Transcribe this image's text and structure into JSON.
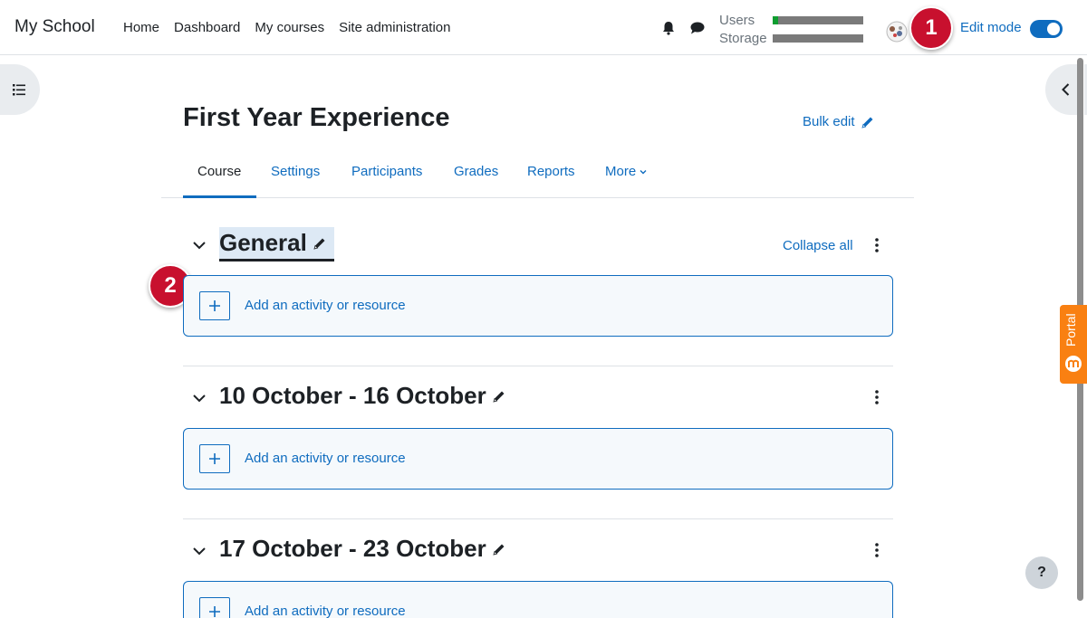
{
  "site": {
    "name": "My School"
  },
  "nav": {
    "items": [
      "Home",
      "Dashboard",
      "My courses",
      "Site administration"
    ]
  },
  "quota": {
    "users_label": "Users",
    "storage_label": "Storage",
    "users_used_fraction": 0.06,
    "storage_used_fraction": 0.0
  },
  "header": {
    "edit_mode_label": "Edit mode",
    "edit_mode_on": true
  },
  "callouts": {
    "first": "1",
    "second": "2"
  },
  "course": {
    "title": "First Year Experience",
    "bulk_edit_label": "Bulk edit",
    "tabs": [
      "Course",
      "Settings",
      "Participants",
      "Grades",
      "Reports",
      "More"
    ],
    "active_tab": "Course",
    "collapse_all_label": "Collapse all",
    "add_activity_label": "Add an activity or resource",
    "sections": [
      {
        "title": "General"
      },
      {
        "title": "10 October - 16 October"
      },
      {
        "title": "17 October - 23 October"
      }
    ]
  },
  "portal": {
    "label": "Portal"
  },
  "help": {
    "label": "?"
  },
  "colors": {
    "accent": "#0f6cbf",
    "callout": "#c8102e",
    "portal": "#f98012"
  },
  "icons": [
    "bell-icon",
    "chat-icon",
    "avatar",
    "index-drawer-icon",
    "chevron-left-icon",
    "pencil-icon",
    "chevron-down-icon",
    "kebab-menu-icon",
    "plus-icon"
  ]
}
